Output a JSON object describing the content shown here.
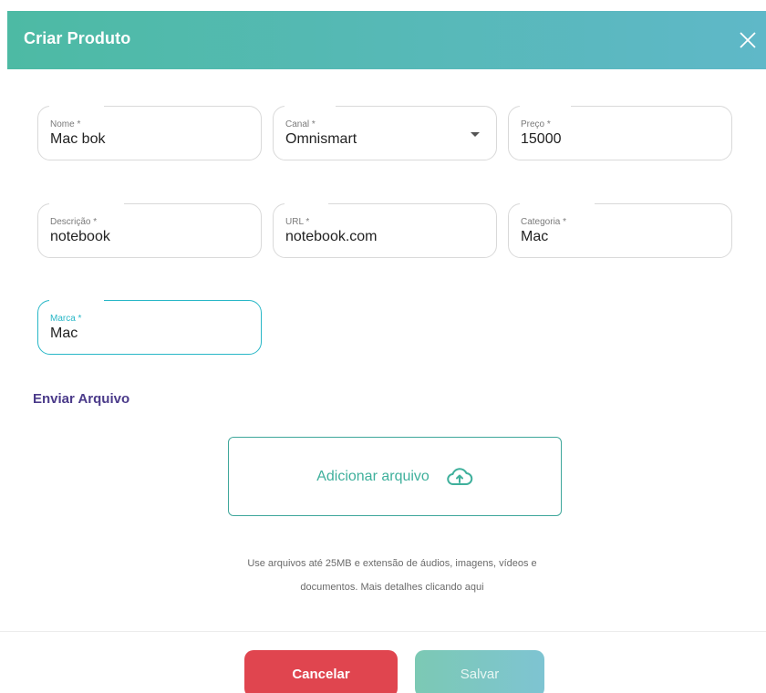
{
  "header": {
    "title": "Criar Produto"
  },
  "form": {
    "nome": {
      "label": "Nome *",
      "value": "Mac bok"
    },
    "canal": {
      "label": "Canal *",
      "value": "Omnismart"
    },
    "preco": {
      "label": "Preço *",
      "value": "15000"
    },
    "descricao": {
      "label": "Descrição *",
      "value": "notebook"
    },
    "url": {
      "label": "URL *",
      "value": "notebook.com"
    },
    "categoria": {
      "label": "Categoria *",
      "value": "Mac"
    },
    "marca": {
      "label": "Marca *",
      "value": "Mac"
    }
  },
  "upload": {
    "section_title": "Enviar Arquivo",
    "button_label": "Adicionar arquivo",
    "hint_line1": "Use arquivos até 25MB e extensão de áudios, imagens, vídeos e",
    "hint_line2": "documentos. Mais detalhes clicando aqui"
  },
  "footer": {
    "cancel_label": "Cancelar",
    "save_label": "Salvar"
  },
  "colors": {
    "header_gradient_start": "#4dbaa4",
    "header_gradient_end": "#5fb8c8",
    "focus": "#28b7c7",
    "section_title": "#4b3b8a",
    "cancel": "#e0454f",
    "upload_accent": "#3fb09c"
  },
  "icons": {
    "close": "close-icon",
    "dropdown": "chevron-down-icon",
    "upload": "cloud-upload-icon"
  }
}
